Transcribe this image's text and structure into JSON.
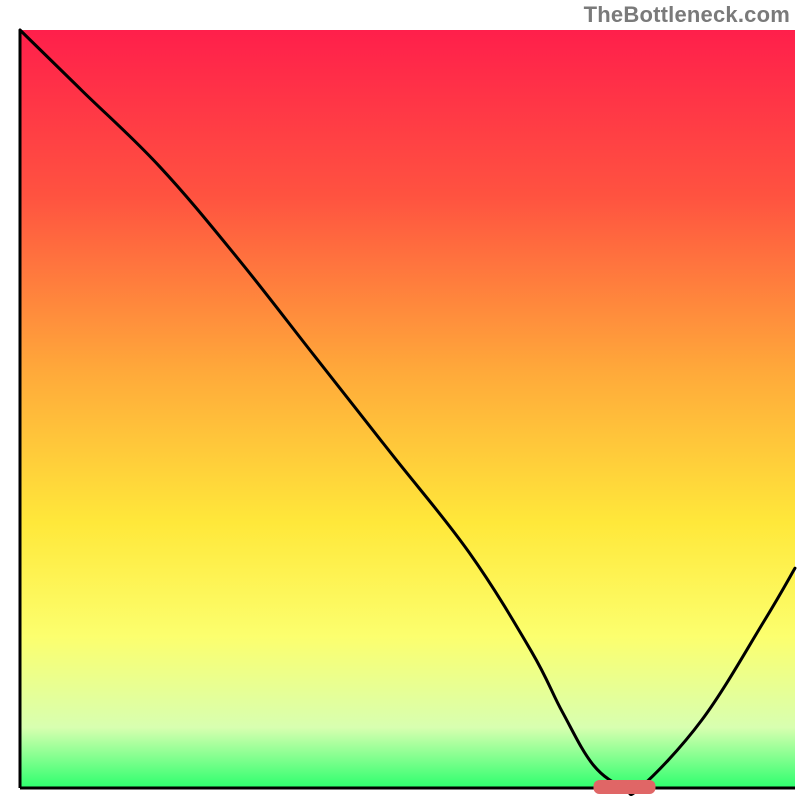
{
  "watermark": "TheBottleneck.com",
  "chart_data": {
    "type": "line",
    "title": "",
    "xlabel": "",
    "ylabel": "",
    "xlim": [
      0,
      100
    ],
    "ylim": [
      0,
      100
    ],
    "grid": false,
    "legend": false,
    "background": {
      "gradient": [
        "#ff1f4b",
        "#ff5340",
        "#ffa93a",
        "#ffe83a",
        "#fcff6e",
        "#d8ffb0",
        "#2dff6e"
      ],
      "stops_pct": [
        0,
        22,
        45,
        65,
        80,
        92,
        100
      ]
    },
    "series": [
      {
        "name": "bottleneck-curve",
        "color": "#000000",
        "x": [
          0,
          8,
          18,
          28,
          38,
          48,
          58,
          66,
          70,
          74,
          78,
          80,
          88,
          96,
          100
        ],
        "values": [
          100,
          92,
          82,
          70,
          57,
          44,
          31,
          18,
          10,
          3,
          0,
          0,
          9,
          22,
          29
        ]
      }
    ],
    "marker": {
      "name": "optimal-range",
      "color": "#e06666",
      "x_start_pct": 74,
      "x_end_pct": 82,
      "y_pct": 0
    },
    "axes": {
      "color": "#000000",
      "left": true,
      "bottom": true,
      "tick_labels": []
    }
  }
}
